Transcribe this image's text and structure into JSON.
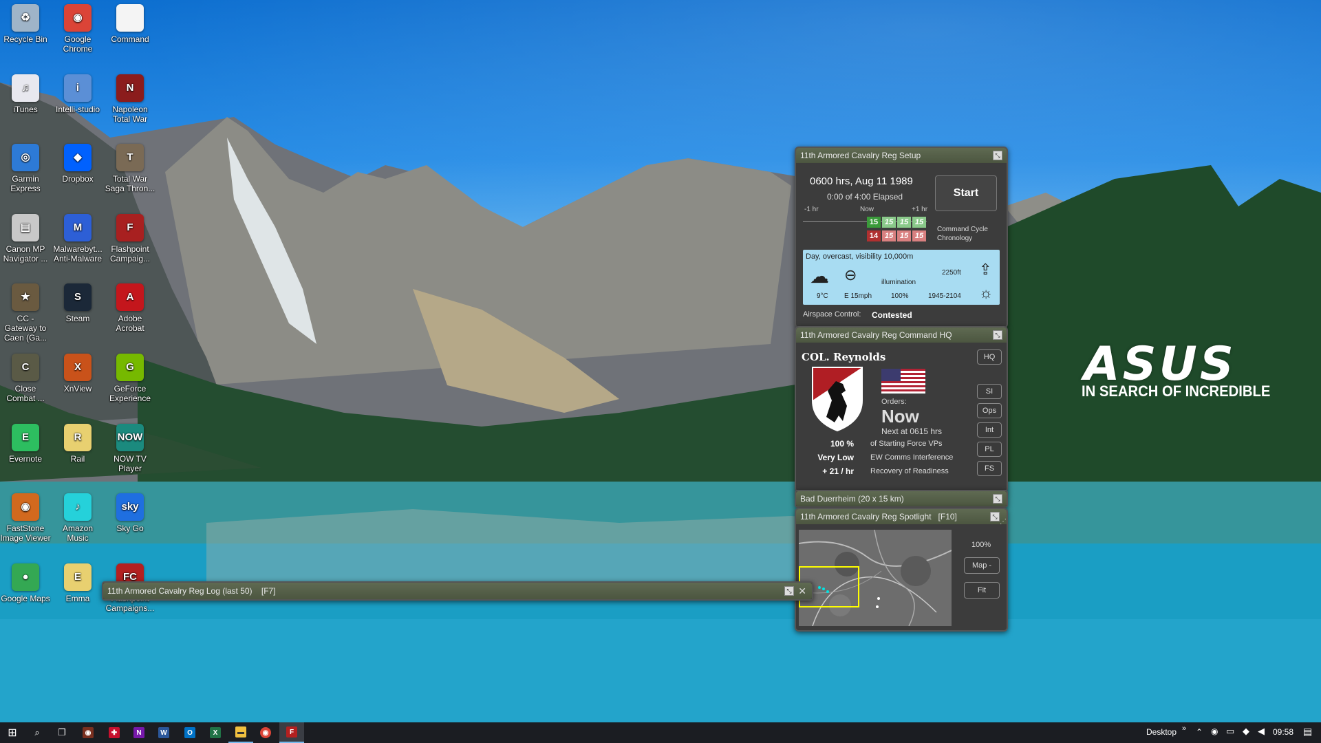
{
  "desktop_icons": [
    {
      "label": "Recycle Bin",
      "icon": "recycle-bin-icon",
      "glyph": "♻",
      "color": "#9fb4c8"
    },
    {
      "label": "Google Chrome",
      "icon": "chrome-icon",
      "glyph": "◉",
      "color": "#db4437"
    },
    {
      "label": "Command",
      "icon": "file-icon",
      "glyph": "",
      "color": "#f4f4f4"
    },
    {
      "label": "iTunes",
      "icon": "itunes-icon",
      "glyph": "♫",
      "color": "#e8e8ef"
    },
    {
      "label": "Intelli-studio",
      "icon": "intelli-studio-icon",
      "glyph": "i",
      "color": "#5b8fd6"
    },
    {
      "label": "Napoleon Total War",
      "icon": "napoleon-icon",
      "glyph": "N",
      "color": "#8b1c1c"
    },
    {
      "label": "Garmin Express",
      "icon": "garmin-icon",
      "glyph": "◎",
      "color": "#2d7ad6"
    },
    {
      "label": "Dropbox",
      "icon": "dropbox-icon",
      "glyph": "◆",
      "color": "#0061fe"
    },
    {
      "label": "Total War Saga Thron...",
      "icon": "total-war-saga-icon",
      "glyph": "T",
      "color": "#7a6a55"
    },
    {
      "label": "Canon MP Navigator ...",
      "icon": "canon-printer-icon",
      "glyph": "▤",
      "color": "#c8c8c8"
    },
    {
      "label": "Malwarebyt... Anti-Malware",
      "icon": "malwarebytes-icon",
      "glyph": "M",
      "color": "#2d5fd6"
    },
    {
      "label": "Flashpoint Campaig...",
      "icon": "flashpoint-icon",
      "glyph": "F",
      "color": "#a82020"
    },
    {
      "label": "CC - Gateway to Caen (Ga...",
      "icon": "close-combat-gateway-icon",
      "glyph": "★",
      "color": "#6a5a40"
    },
    {
      "label": "Steam",
      "icon": "steam-icon",
      "glyph": "S",
      "color": "#1b2838"
    },
    {
      "label": "Adobe Acrobat",
      "icon": "acrobat-icon",
      "glyph": "A",
      "color": "#c4161c"
    },
    {
      "label": "Close Combat ...",
      "icon": "close-combat-icon",
      "glyph": "C",
      "color": "#5a5a46"
    },
    {
      "label": "XnView",
      "icon": "xnview-icon",
      "glyph": "X",
      "color": "#c9521a"
    },
    {
      "label": "GeForce Experience",
      "icon": "geforce-icon",
      "glyph": "G",
      "color": "#76b900"
    },
    {
      "label": "Evernote",
      "icon": "evernote-icon",
      "glyph": "E",
      "color": "#2dbe60"
    },
    {
      "label": "Rail",
      "icon": "rail-icon",
      "glyph": "R",
      "color": "#e8d070"
    },
    {
      "label": "NOW TV Player",
      "icon": "now-tv-icon",
      "glyph": "NOW",
      "color": "#1b8a7e"
    },
    {
      "label": "FastStone Image Viewer",
      "icon": "faststone-icon",
      "glyph": "◉",
      "color": "#d2691e"
    },
    {
      "label": "Amazon Music",
      "icon": "amazon-music-icon",
      "glyph": "♪",
      "color": "#25d1da"
    },
    {
      "label": "Sky Go",
      "icon": "sky-go-icon",
      "glyph": "sky",
      "color": "#1f6fe0"
    },
    {
      "label": "Google Maps",
      "icon": "google-maps-icon",
      "glyph": "●",
      "color": "#34a853"
    },
    {
      "label": "Emma",
      "icon": "emma-icon",
      "glyph": "E",
      "color": "#e8d070"
    },
    {
      "label": "Flashpoint Campaigns...",
      "icon": "flashpoint-campaigns-icon",
      "glyph": "FC",
      "color": "#b32020"
    }
  ],
  "branding": {
    "logo": "ASUS",
    "tagline": "IN SEARCH OF INCREDIBLE"
  },
  "setup": {
    "title": "11th Armored Cavalry Reg Setup",
    "datetime": "0600 hrs, Aug 11 1989",
    "elapsed": "0:00 of 4:00 Elapsed",
    "start": "Start",
    "minus": "-1 hr",
    "now": "Now",
    "plus": "+1 hr",
    "row1": [
      "15",
      "15",
      "15",
      "15"
    ],
    "row2": [
      "14",
      "15",
      "15",
      "15"
    ],
    "chronology": "Command Cycle Chronology",
    "weather": "Day, overcast, visibility 10,000m",
    "ceiling": "2250ft",
    "illum_label": "illumination",
    "temp": "9°C",
    "wind": "E 15mph",
    "illum": "100%",
    "daylight": "1945-2104",
    "airspace_label": "Airspace Control:",
    "airspace_value": "Contested"
  },
  "hq": {
    "title": "11th Armored Cavalry Reg Command HQ",
    "commander": "COL. Reynolds",
    "orders_label": "Orders:",
    "orders": "Now",
    "next": "Next at 0615 hrs",
    "buttons": [
      "HQ",
      "SI",
      "Ops",
      "Int",
      "PL",
      "FS"
    ],
    "stats": [
      {
        "v": "100 %",
        "l": "of Starting Force VPs"
      },
      {
        "v": "Very Low",
        "l": "EW Comms Interference"
      },
      {
        "v": "+ 21 / hr",
        "l": "Recovery of Readiness"
      }
    ]
  },
  "map_panel": {
    "title": "Bad Duerrheim (20 x 15 km)"
  },
  "spotlight": {
    "title": "11th Armored Cavalry Reg Spotlight   [F10]",
    "zoom": "100%",
    "map_btn": "Map -",
    "fit_btn": "Fit"
  },
  "log": {
    "title": "11th Armored Cavalry Reg Log (last 50)    [F7]"
  },
  "taskbar": {
    "desktop": "Desktop",
    "time": "09:58"
  }
}
